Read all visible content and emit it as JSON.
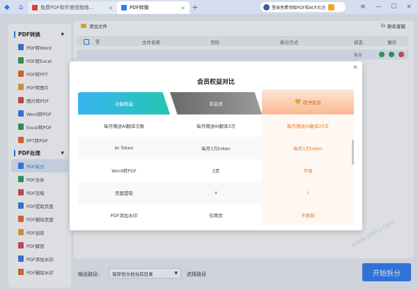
{
  "titlebar": {
    "tabs": [
      {
        "label": "免费PDF软件使用指南..."
      },
      {
        "label": "PDF转换"
      }
    ],
    "promo": "登录免费领取PDF和AI大礼包"
  },
  "sidebar": {
    "sections": [
      {
        "title": "PDF转换",
        "items": [
          "PDF转Word",
          "PDF转Excel",
          "PDF转PPT",
          "PDF转图片",
          "图片转PDF",
          "Word转PDF",
          "Excel转PDF",
          "PPT转PDF"
        ]
      },
      {
        "title": "PDF处理",
        "items": [
          "PDF拆分",
          "PDF合并",
          "PDF压缩",
          "PDF提取页面",
          "PDF删除页面",
          "PDF加密",
          "PDF解密",
          "PDF添加水印",
          "PDF删除水印"
        ]
      }
    ],
    "active_item": "PDF拆分"
  },
  "toolbar": {
    "add_file": "添加文件",
    "support": "联系客服"
  },
  "table": {
    "headers": [
      "文件名称",
      "页码",
      "拆分方式",
      "状态",
      "操作"
    ],
    "row_status": "拆分"
  },
  "bottom": {
    "output_label": "输出路径:",
    "output_value": "保存到文档当前目录",
    "choose_path": "选择路径",
    "start_button": "开始拆分"
  },
  "modal": {
    "title": "会员权益对比",
    "columns": [
      "功能权益",
      "非会员",
      "超书会员"
    ],
    "rows": [
      [
        "每月赠送AI翻译次数",
        "每月赠送AI翻译3次",
        "每月赠送AI翻译20次"
      ],
      [
        "AI Token",
        "每月1万token",
        "每月1万token"
      ],
      [
        "Word转PDF",
        "2页",
        "不限"
      ],
      [
        "页面提取",
        "x",
        "√"
      ],
      [
        "PDF添加水印",
        "仅两页",
        "不限制"
      ]
    ]
  },
  "watermark": "www.yesky.com",
  "colors": {
    "accent": "#2f7cf6",
    "vip": "#e87a2b"
  }
}
